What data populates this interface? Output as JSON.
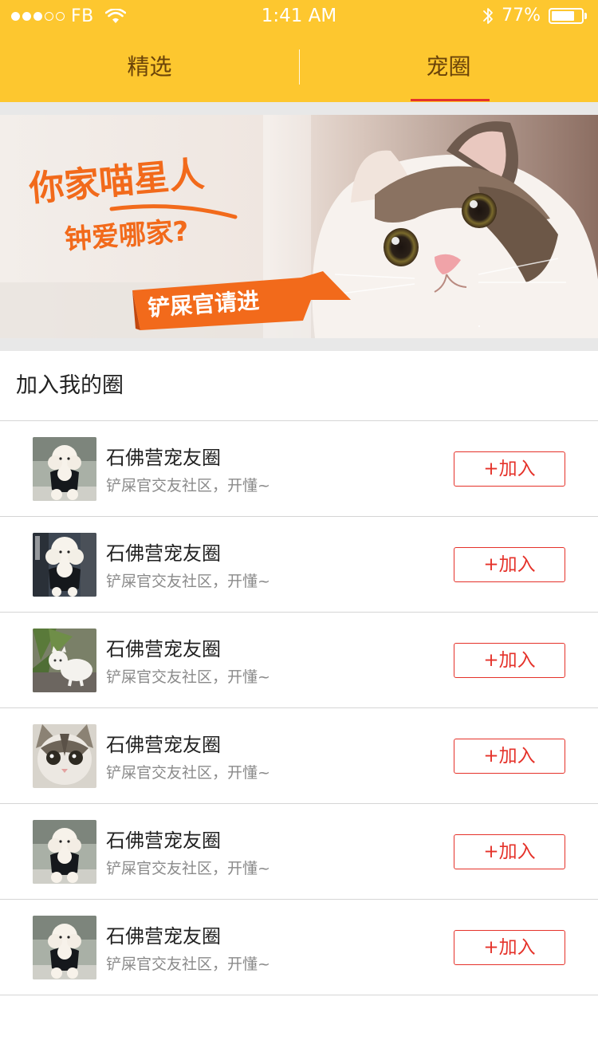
{
  "status_bar": {
    "carrier": "FB",
    "time": "1:41 AM",
    "battery": "77%",
    "battery_level": 0.77,
    "signal_bars_filled": 3,
    "signal_bars_total": 5
  },
  "tabs": [
    {
      "label": "精选",
      "selected": false
    },
    {
      "label": "宠圈",
      "selected": true
    }
  ],
  "banner": {
    "line1": "你家喵星人",
    "line2": "钟爱哪家?",
    "cta": "铲屎官请进"
  },
  "section": {
    "title": "加入我的圈"
  },
  "circles": [
    {
      "name": "石佛营宠友圈",
      "desc": "铲屎官交友社区，开懂~",
      "button": "+加入",
      "avatar": "poodle-icon"
    },
    {
      "name": "石佛营宠友圈",
      "desc": "铲屎官交友社区，开懂~",
      "button": "+加入",
      "avatar": "poodle-icon"
    },
    {
      "name": "石佛营宠友圈",
      "desc": "铲屎官交友社区，开懂~",
      "button": "+加入",
      "avatar": "white-cat-icon"
    },
    {
      "name": "石佛营宠友圈",
      "desc": "铲屎官交友社区，开懂~",
      "button": "+加入",
      "avatar": "kitten-icon"
    },
    {
      "name": "石佛营宠友圈",
      "desc": "铲屎官交友社区，开懂~",
      "button": "+加入",
      "avatar": "poodle-icon"
    },
    {
      "name": "石佛营宠友圈",
      "desc": "铲屎官交友社区，开懂~",
      "button": "+加入",
      "avatar": "poodle-icon"
    }
  ],
  "colors": {
    "header_bg": "#fdc72f",
    "tab_text": "#6a4309",
    "accent_red": "#e5322a",
    "banner_orange": "#f26a1b"
  }
}
